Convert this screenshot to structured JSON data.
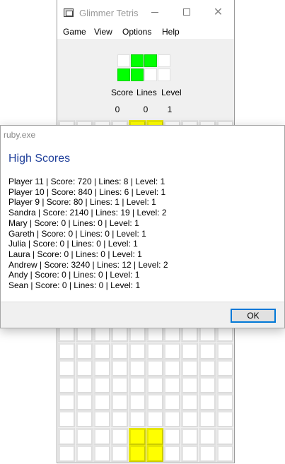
{
  "window": {
    "title": "Glimmer Tetris",
    "close_glyph": "✕"
  },
  "menu": {
    "items": [
      "Game",
      "View",
      "Options",
      "Help"
    ]
  },
  "stats": {
    "labels": [
      "Score",
      "Lines",
      "Level"
    ],
    "values": [
      "0",
      "0",
      "1"
    ]
  },
  "colors": {
    "preview_piece": "#00ff00",
    "board_piece": "#ffff00",
    "dialog_heading": "#1f3f9a"
  },
  "dialog": {
    "title": "ruby.exe",
    "heading": "High Scores",
    "scores": [
      "Player 11 | Score: 720 | Lines: 8 | Level: 1",
      "Player 10 | Score: 840 | Lines: 6 | Level: 1",
      "Player 9 | Score: 80 | Lines: 1 | Level: 1",
      "Sandra | Score: 2140 | Lines: 19 | Level: 2",
      "Mary | Score: 0 | Lines: 0 | Level: 1",
      "Gareth | Score: 0 | Lines: 0 | Level: 1",
      "Julia | Score: 0 | Lines: 0 | Level: 1",
      "Laura | Score: 0 | Lines: 0 | Level: 1",
      "Andrew | Score: 3240 | Lines: 12 | Level: 2",
      "Andy | Score: 0 | Lines: 0 | Level: 1",
      "Sean | Score: 0 | Lines: 0 | Level: 1"
    ],
    "ok_label": "OK"
  }
}
